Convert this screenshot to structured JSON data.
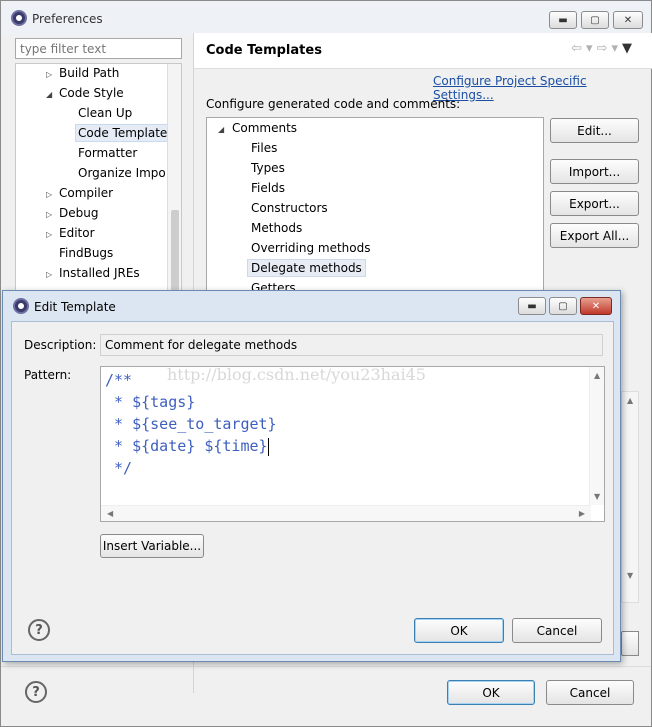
{
  "preferences": {
    "title": "Preferences",
    "filter_placeholder": "type filter text",
    "tree": [
      {
        "label": "Build Path",
        "arrow": "▷"
      },
      {
        "label": "Code Style",
        "arrow": "◢"
      },
      {
        "label": "Clean Up",
        "arrow": ""
      },
      {
        "label": "Code Template",
        "arrow": ""
      },
      {
        "label": "Formatter",
        "arrow": ""
      },
      {
        "label": "Organize Impo",
        "arrow": ""
      },
      {
        "label": "Compiler",
        "arrow": "▷"
      },
      {
        "label": "Debug",
        "arrow": "▷"
      },
      {
        "label": "Editor",
        "arrow": "▷"
      },
      {
        "label": "FindBugs",
        "arrow": ""
      },
      {
        "label": "Installed JREs",
        "arrow": "▷"
      }
    ],
    "page_title": "Code Templates",
    "configure_link": "Configure Project Specific Settings...",
    "configure_label": "Configure generated code and comments:",
    "templates": {
      "root": "Comments",
      "root_arrow": "◢",
      "items": [
        "Files",
        "Types",
        "Fields",
        "Constructors",
        "Methods",
        "Overriding methods",
        "Delegate methods",
        "Getters"
      ]
    },
    "buttons": {
      "edit": "Edit...",
      "import": "Import...",
      "export": "Export...",
      "export_all": "Export All..."
    },
    "ok": "OK",
    "cancel": "Cancel",
    "help": "?"
  },
  "edit_template": {
    "title": "Edit Template",
    "description_label": "Description:",
    "description_value": "Comment for delegate methods",
    "pattern_label": "Pattern:",
    "pattern_lines": [
      "/**",
      " * ${tags}",
      " * ${see_to_target}",
      " * ${date} ${time}",
      " */"
    ],
    "watermark": "http://blog.csdn.net/you23hai45",
    "insert_variable": "Insert Variable...",
    "ok": "OK",
    "cancel": "Cancel",
    "help": "?"
  },
  "window_controls": {
    "minimize": "▬",
    "maximize": "▢",
    "close": "✕"
  },
  "colors": {
    "link": "#1a4fa3",
    "code": "#3f5fbf",
    "selection": "#e5ecf6",
    "dialog_frame": "#dce6f2"
  }
}
